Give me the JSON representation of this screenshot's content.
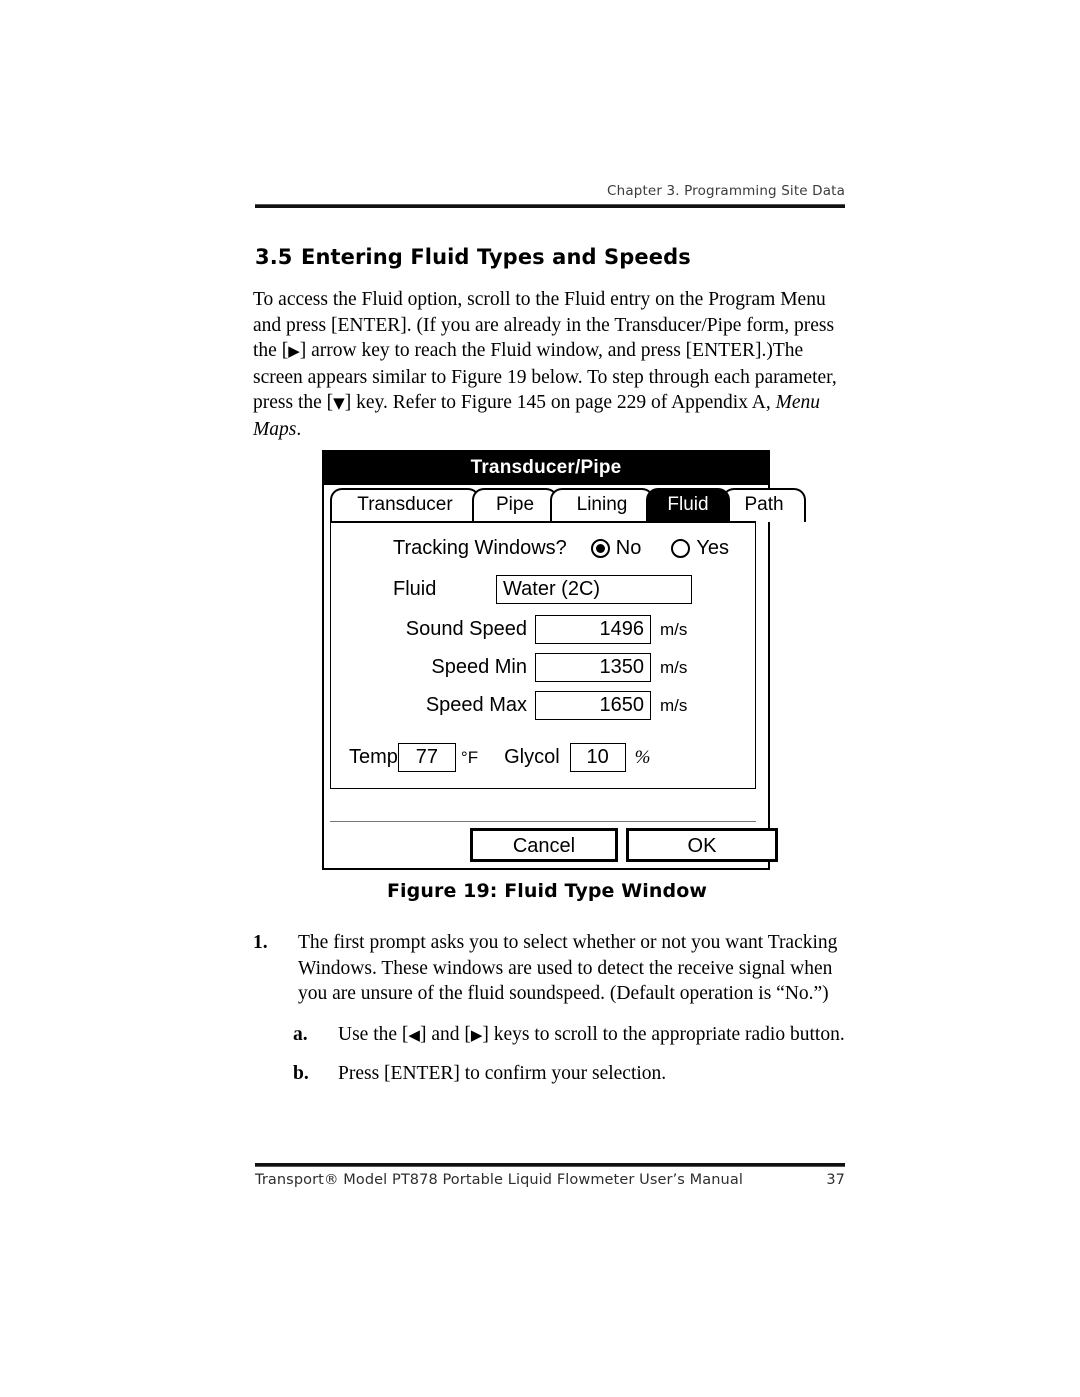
{
  "header": {
    "running_head": "Chapter 3. Programming Site Data"
  },
  "section": {
    "number": "3.5",
    "title": "Entering Fluid Types and Speeds"
  },
  "intro": {
    "part1": "To access the Fluid option, scroll to the Fluid entry on the Program Menu and press [ENTER]. (If you are already in the Transducer/Pipe form, press the [",
    "part2": "] arrow key to reach the Fluid window, and press [ENTER].)The screen appears similar to Figure 19 below. To step through each parameter, press the [",
    "part3": "] key. Refer to Figure 145 on page 229 of Appendix A, ",
    "italic_ref": "Menu Maps",
    "part4": "."
  },
  "dialog": {
    "title": "Transducer/Pipe",
    "tabs": [
      {
        "label": "Transducer",
        "selected": false
      },
      {
        "label": "Pipe",
        "selected": false
      },
      {
        "label": "Lining",
        "selected": false
      },
      {
        "label": "Fluid",
        "selected": true
      },
      {
        "label": "Path",
        "selected": false
      }
    ],
    "tracking_windows": {
      "label": "Tracking Windows?",
      "option_no": "No",
      "option_yes": "Yes",
      "selected": "No"
    },
    "fields": {
      "fluid_label": "Fluid",
      "fluid_value": "Water (2C)",
      "sound_speed_label": "Sound Speed",
      "sound_speed_value": "1496",
      "sound_speed_unit": "m/s",
      "speed_min_label": "Speed Min",
      "speed_min_value": "1350",
      "speed_min_unit": "m/s",
      "speed_max_label": "Speed Max",
      "speed_max_value": "1650",
      "speed_max_unit": "m/s",
      "temp_label": "Temp",
      "temp_value": "77",
      "temp_unit": "°F",
      "glycol_label": "Glycol",
      "glycol_value": "10",
      "glycol_unit": "%"
    },
    "buttons": {
      "cancel": "Cancel",
      "ok": "OK"
    }
  },
  "figure": {
    "caption": "Figure 19: Fluid Type Window"
  },
  "steps": [
    {
      "marker": "1.",
      "text": "The first prompt asks you to select whether or not you want Tracking Windows. These windows are used to detect the receive signal when you are unsure of the fluid soundspeed. (Default operation is “No.”)"
    }
  ],
  "substeps": [
    {
      "marker": "a.",
      "text_before": "Use the [",
      "text_middle": "] and [",
      "text_after": "] keys to scroll to the appropriate radio button."
    },
    {
      "marker": "b.",
      "text": "Press [ENTER] to confirm your selection."
    }
  ],
  "footer": {
    "manual_title": "Transport® Model PT878 Portable Liquid Flowmeter User’s Manual",
    "page_number": "37"
  }
}
